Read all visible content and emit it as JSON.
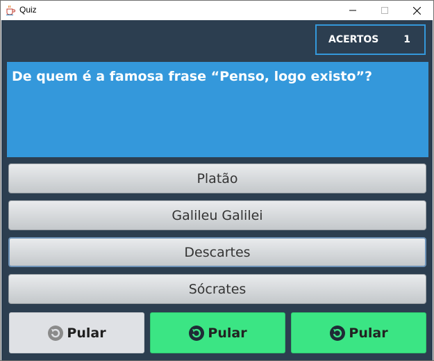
{
  "window": {
    "title": "Quiz"
  },
  "score": {
    "label": "ACERTOS",
    "value": "1"
  },
  "question": {
    "text": "De quem é a famosa frase “Penso, logo existo”?"
  },
  "answers": [
    {
      "label": "Platão"
    },
    {
      "label": "Galileu Galilei"
    },
    {
      "label": "Descartes"
    },
    {
      "label": "Sócrates"
    }
  ],
  "skips": [
    {
      "label": "Pular",
      "state": "disabled"
    },
    {
      "label": "Pular",
      "state": "enabled"
    },
    {
      "label": "Pular",
      "state": "enabled"
    }
  ],
  "colors": {
    "background": "#2c3e50",
    "question_panel": "#3498db",
    "skip_enabled": "#3be584",
    "skip_disabled": "#dfe1e5"
  },
  "icons": {
    "app": "java-cup-icon",
    "skip": "skip-rotate-icon",
    "minimize": "minimize-icon",
    "maximize": "maximize-icon",
    "close": "close-icon"
  }
}
